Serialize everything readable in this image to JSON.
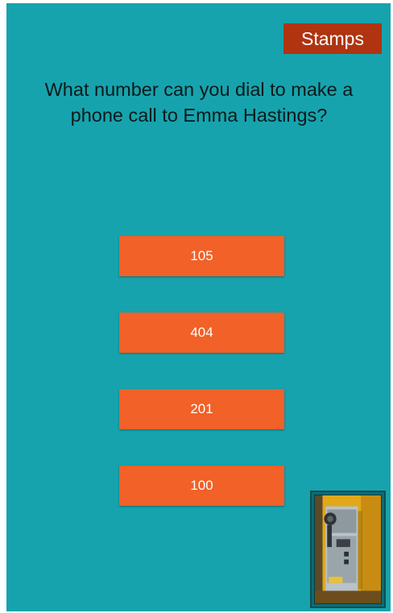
{
  "header": {
    "stamps_label": "Stamps"
  },
  "question": {
    "text": "What number can you dial to make a phone call to Emma Hastings?"
  },
  "answers": [
    {
      "label": "105"
    },
    {
      "label": "404"
    },
    {
      "label": "201"
    },
    {
      "label": "100"
    }
  ],
  "thumbnail": {
    "subject": "wall-mounted payphone photo"
  },
  "colors": {
    "background": "#17a3ad",
    "answer_button": "#f16128",
    "stamps_button": "#b03410",
    "question_text": "#0b1a1c"
  }
}
